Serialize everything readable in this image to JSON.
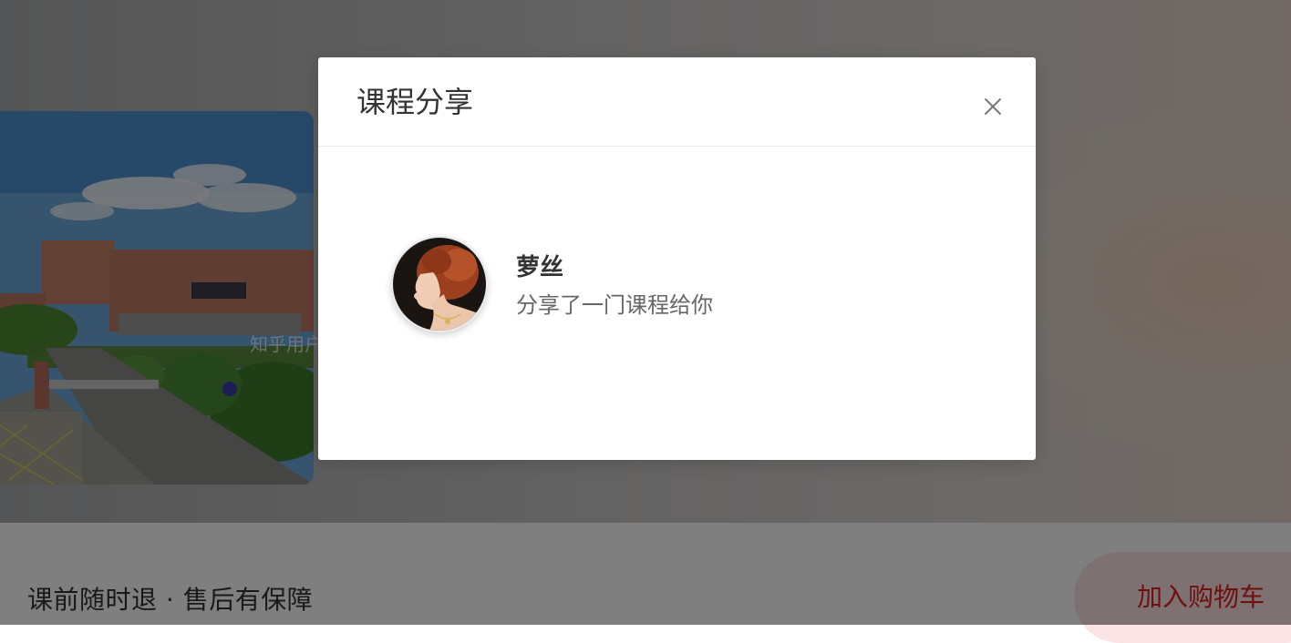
{
  "page": {
    "cover_watermark": "知乎用户",
    "guarantee_text": "课前随时退 · 售后有保障",
    "add_to_cart_label": "加入购物车"
  },
  "modal": {
    "title": "课程分享",
    "close_icon": "close-icon",
    "sharer": {
      "name": "萝丝",
      "message": "分享了一门课程给你"
    }
  },
  "colors": {
    "overlay": "#00000080",
    "accent_red": "#e01f1f",
    "cart_button_bg": "#fbe3e3",
    "title_text": "#333333",
    "secondary_text": "#666666"
  }
}
